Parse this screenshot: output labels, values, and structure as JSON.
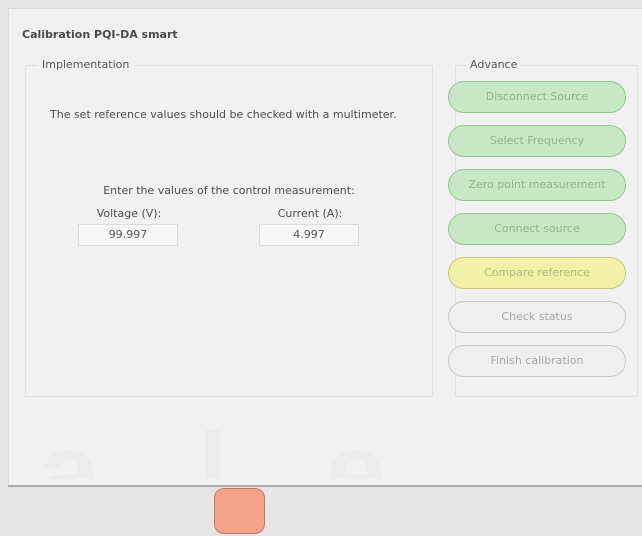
{
  "window": {
    "title": "Calibration PQI-DA smart"
  },
  "implementation": {
    "label": "Implementation",
    "instruction": "The set reference values should be checked with a multimeter.",
    "prompt": "Enter the values of the control measurement:",
    "voltage_label": "Voltage (V):",
    "voltage_value": "99.997",
    "current_label": "Current (A):",
    "current_value": "4.997"
  },
  "advance": {
    "label": "Advance",
    "steps": [
      {
        "label": "Disconnect Source",
        "state": "done"
      },
      {
        "label": "Select Frequency",
        "state": "done"
      },
      {
        "label": "Zero point measurement",
        "state": "done"
      },
      {
        "label": "Connect source",
        "state": "done"
      },
      {
        "label": "Compare reference",
        "state": "active"
      },
      {
        "label": "Check status",
        "state": "pending"
      },
      {
        "label": "Finish calibration",
        "state": "pending"
      }
    ]
  },
  "colors": {
    "step_done": "#c8e7c4",
    "step_active": "#f3f0a7",
    "step_pending": "#efefef",
    "footer_button": "#f3a48a"
  }
}
